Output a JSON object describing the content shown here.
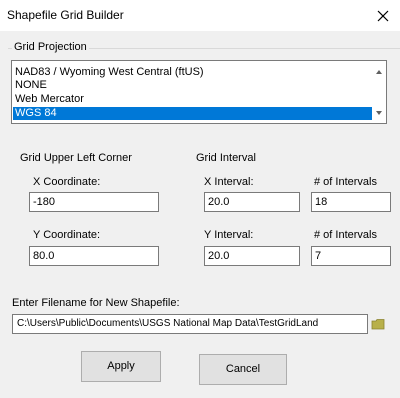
{
  "window": {
    "title": "Shapefile Grid Builder",
    "close_symbol": "✕"
  },
  "projection": {
    "group_label": "Grid Projection",
    "options": [
      "NAD83 / Wyoming West Central (ftUS)",
      "NONE",
      "Web Mercator",
      "WGS 84"
    ],
    "selected": "WGS 84"
  },
  "corner": {
    "title": "Grid Upper Left Corner",
    "x_label": "X Coordinate:",
    "x_value": "-180",
    "y_label": "Y Coordinate:",
    "y_value": "80.0"
  },
  "interval": {
    "title": "Grid Interval",
    "x_label": "X Interval:",
    "x_value": "20.0",
    "y_label": "Y Interval:",
    "y_value": "20.0",
    "x_count_label": "# of Intervals",
    "x_count_value": "18",
    "y_count_label": "# of Intervals",
    "y_count_value": "7"
  },
  "file": {
    "label": "Enter Filename for New Shapefile:",
    "value": "C:\\Users\\Public\\Documents\\USGS National Map Data\\TestGridLand",
    "browse_icon": "folder-icon",
    "folder_color": "#b8b04a"
  },
  "buttons": {
    "apply": "Apply",
    "cancel": "Cancel"
  },
  "colors": {
    "selection": "#0078d7"
  }
}
